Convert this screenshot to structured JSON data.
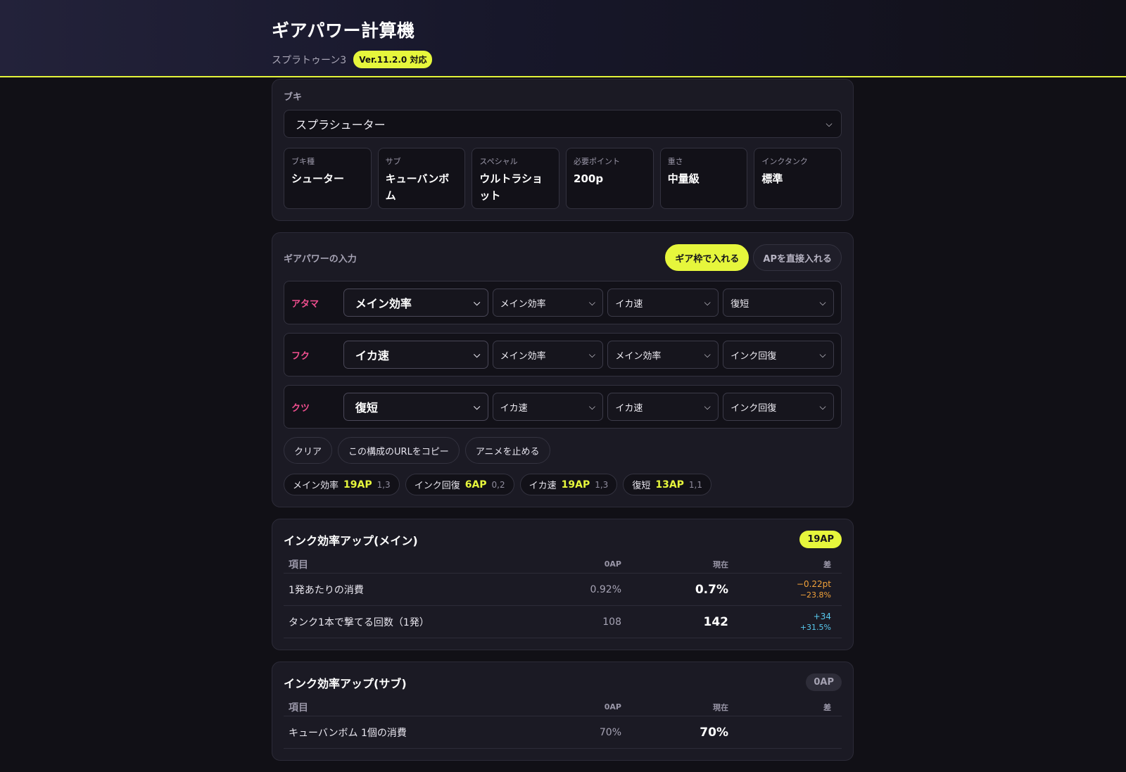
{
  "header": {
    "title": "ギアパワー計算機",
    "subtitle": "スプラトゥーン3",
    "version": "Ver.11.2.0 対応"
  },
  "weapon": {
    "label": "ブキ",
    "selected": "スプラシューター",
    "stats": [
      {
        "label": "ブキ種",
        "value": "シューター"
      },
      {
        "label": "サブ",
        "value": "キューバンボム"
      },
      {
        "label": "スペシャル",
        "value": "ウルトラショット"
      },
      {
        "label": "必要ポイント",
        "value": "200p"
      },
      {
        "label": "重さ",
        "value": "中量級"
      },
      {
        "label": "インクタンク",
        "value": "標準"
      }
    ]
  },
  "gear_input": {
    "title": "ギアパワーの入力",
    "tabs": [
      {
        "label": "ギア枠で入れる",
        "active": true
      },
      {
        "label": "APを直接入れる",
        "active": false
      }
    ],
    "rows": [
      {
        "label": "アタマ",
        "main": "メイン効率",
        "subs": [
          "メイン効率",
          "イカ速",
          "復短"
        ]
      },
      {
        "label": "フク",
        "main": "イカ速",
        "subs": [
          "メイン効率",
          "メイン効率",
          "インク回復"
        ]
      },
      {
        "label": "クツ",
        "main": "復短",
        "subs": [
          "イカ速",
          "イカ速",
          "インク回復"
        ]
      }
    ],
    "actions": {
      "clear": "クリア",
      "copy_url": "この構成のURLをコピー",
      "stop_anim": "アニメを止める"
    },
    "summary": [
      {
        "name": "メイン効率",
        "ap": "19AP",
        "detail": "1,3"
      },
      {
        "name": "インク回復",
        "ap": "6AP",
        "detail": "0,2"
      },
      {
        "name": "イカ速",
        "ap": "19AP",
        "detail": "1,3"
      },
      {
        "name": "復短",
        "ap": "13AP",
        "detail": "1,1"
      }
    ]
  },
  "effects": [
    {
      "title": "インク効率アップ(メイン)",
      "ap": "19AP",
      "headers": {
        "item": "項目",
        "base": "0AP",
        "current": "現在",
        "diff": "差"
      },
      "rows": [
        {
          "item": "1発あたりの消費",
          "base": "0.92%",
          "current": "0.7%",
          "diff": "−0.22pt",
          "pct": "−23.8%"
        },
        {
          "item": "タンク1本で撃てる回数（1発）",
          "base": "108",
          "current": "142",
          "diff": "+34",
          "pct": "+31.5%"
        }
      ]
    },
    {
      "title": "インク効率アップ(サブ)",
      "ap": "0AP",
      "headers": {
        "item": "項目",
        "base": "0AP",
        "current": "現在",
        "diff": "差"
      },
      "rows": [
        {
          "item": "キューバンボム 1個の消費",
          "base": "70%",
          "current": "70%",
          "diff": "",
          "pct": ""
        }
      ]
    }
  ],
  "colors": {
    "accent": "#e6f63c",
    "gear_label": "#f04f8f",
    "diff_down": "#f2a23a",
    "diff_up": "#58c9ee"
  },
  "icons": {
    "select_chevron": "chevron-down-icon"
  }
}
